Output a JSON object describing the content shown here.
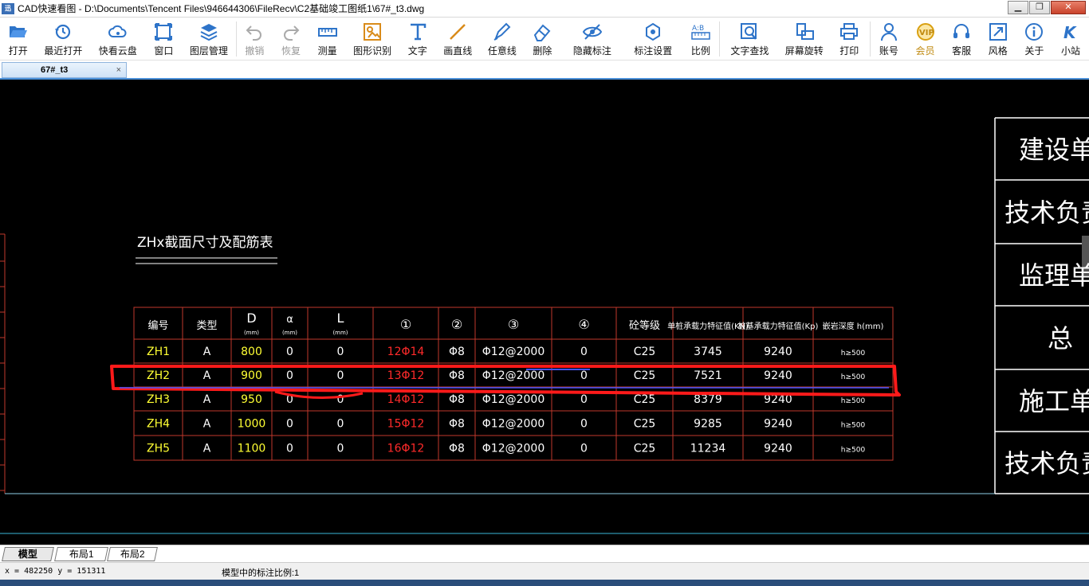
{
  "window": {
    "logo": "迅",
    "title": "CAD快速看图 - D:\\Documents\\Tencent Files\\946644306\\FileRecv\\C2基础竣工图纸1\\67#_t3.dwg",
    "min": "▁",
    "max": "❐",
    "close": "✕"
  },
  "toolbar": [
    {
      "label": "打开",
      "icon": "folder-open-icon"
    },
    {
      "label": "最近打开",
      "icon": "history-icon"
    },
    {
      "label": "快看云盘",
      "icon": "cloud-icon"
    },
    {
      "label": "窗口",
      "icon": "window-icon"
    },
    {
      "label": "图层管理",
      "icon": "layers-icon"
    },
    {
      "label": "撤销",
      "icon": "undo-icon",
      "disabled": true
    },
    {
      "label": "恢复",
      "icon": "redo-icon",
      "disabled": true
    },
    {
      "label": "测量",
      "icon": "measure-icon"
    },
    {
      "label": "图形识别",
      "icon": "shape-recognize-icon"
    },
    {
      "label": "文字",
      "icon": "text-icon"
    },
    {
      "label": "画直线",
      "icon": "line-icon"
    },
    {
      "label": "任意线",
      "icon": "pen-icon"
    },
    {
      "label": "删除",
      "icon": "eraser-icon"
    },
    {
      "label": "隐藏标注",
      "icon": "eye-hide-icon"
    },
    {
      "label": "标注设置",
      "icon": "annotation-settings-icon"
    },
    {
      "label": "比例",
      "icon": "scale-icon"
    },
    {
      "label": "文字查找",
      "icon": "text-search-icon"
    },
    {
      "label": "屏幕旋转",
      "icon": "rotate-screen-icon"
    },
    {
      "label": "打印",
      "icon": "print-icon"
    },
    {
      "label": "账号",
      "icon": "user-icon"
    },
    {
      "label": "会员",
      "icon": "vip-icon",
      "vip": true
    },
    {
      "label": "客服",
      "icon": "headset-icon"
    },
    {
      "label": "风格",
      "icon": "style-icon"
    },
    {
      "label": "关于",
      "icon": "info-icon"
    },
    {
      "label": "小站",
      "icon": "k-station-icon"
    }
  ],
  "doc_tab": {
    "name": "67#_t3",
    "close": "×"
  },
  "drawing": {
    "table_title": "ZHx截面尺寸及配筋表",
    "headers": [
      "编号",
      "类型",
      "D",
      "α",
      "L",
      "①",
      "②",
      "③",
      "④",
      "砼等级",
      "单桩承载力特征值(KN)",
      "桩基承载力特征值(Kp)",
      "嵌岩深度 h(mm)"
    ],
    "header_units": {
      "D": "(mm)",
      "α": "(mm)",
      "L": "(mm)"
    },
    "rows": [
      [
        "ZH1",
        "A",
        "800",
        "0",
        "0",
        "12Φ14",
        "Φ8",
        "Φ12@2000",
        "0",
        "C25",
        "3745",
        "9240",
        "h≥500"
      ],
      [
        "ZH2",
        "A",
        "900",
        "0",
        "0",
        "13Φ12",
        "Φ8",
        "Φ12@2000",
        "0",
        "C25",
        "7521",
        "9240",
        "h≥500"
      ],
      [
        "ZH3",
        "A",
        "950",
        "0",
        "0",
        "14Φ12",
        "Φ8",
        "Φ12@2000",
        "0",
        "C25",
        "8379",
        "9240",
        "h≥500"
      ],
      [
        "ZH4",
        "A",
        "1000",
        "0",
        "0",
        "15Φ12",
        "Φ8",
        "Φ12@2000",
        "0",
        "C25",
        "9285",
        "9240",
        "h≥500"
      ],
      [
        "ZH5",
        "A",
        "1100",
        "0",
        "0",
        "16Φ12",
        "Φ8",
        "Φ12@2000",
        "0",
        "C25",
        "11234",
        "9240",
        "h≥500"
      ]
    ],
    "title_block": [
      "建设单位",
      "技术负责",
      "监理单位",
      "总",
      "施工单位",
      "技术负责"
    ]
  },
  "layout_tabs": [
    "模型",
    "布局1",
    "布局2"
  ],
  "status": {
    "coords": "x = 482250  y = 151311",
    "scale_text": "模型中的标注比例:1"
  },
  "colors": {
    "line_red": "#c0392b",
    "text_white": "#ffffff",
    "text_yellow": "#ffff33",
    "text_red": "#ff2a2a",
    "highlight_red": "#ff1a1a",
    "accent_blue": "#4a90d9"
  }
}
